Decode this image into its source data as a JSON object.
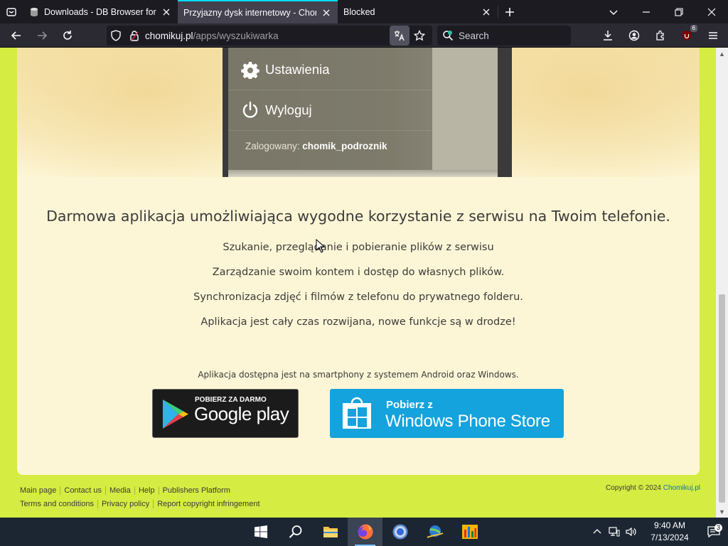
{
  "browser": {
    "tabs": [
      {
        "title": "Downloads - DB Browser for SQL",
        "active": false
      },
      {
        "title": "Przyjazny dysk internetowy - Chomik",
        "active": true
      },
      {
        "title": "Blocked",
        "active": false
      }
    ],
    "url_host": "chomikuj.pl",
    "url_path": "/apps/wyszukiwarka",
    "search_placeholder": "Search",
    "extension_badge": "6"
  },
  "phone_menu": {
    "settings_label": "Ustawienia",
    "logout_label": "Wyloguj",
    "logged_prefix": "Zalogowany: ",
    "logged_user": "chomik_podroznik"
  },
  "content": {
    "headline": "Darmowa aplikacja umożliwiająca wygodne korzystanie z serwisu na Twoim telefonie.",
    "features": [
      "Szukanie, przeglądanie i pobieranie plików z serwisu",
      "Zarządzanie swoim kontem i dostęp do własnych plików.",
      "Synchronizacja zdjęć i filmów z telefonu do prywatnego folderu.",
      "Aplikacja jest cały czas rozwijana, nowe funkcje są w drodze!"
    ],
    "availability": "Aplikacja dostępna jest na smartphony z systemem Android oraz Windows.",
    "google_play_small": "POBIERZ ZA DARMO",
    "google_play_big": "Google play",
    "windows_small": "Pobierz z",
    "windows_big": "Windows Phone Store"
  },
  "footer": {
    "links_row1": [
      "Main page",
      "Contact us",
      "Media",
      "Help",
      "Publishers Platform"
    ],
    "links_row2": [
      "Terms and conditions",
      "Privacy policy",
      "Report copyright infringement"
    ],
    "copyright_prefix": "Copyright © 2024 ",
    "copyright_brand": "Chomikuj.pl"
  },
  "taskbar": {
    "time": "9:40 AM",
    "date": "7/13/2024",
    "notification_count": "3"
  },
  "colors": {
    "page_bg": "#d5ec42",
    "card_bg": "#fdf6d6",
    "tab_accent": "#00ddff",
    "windows_store_blue": "#14a3dc"
  }
}
